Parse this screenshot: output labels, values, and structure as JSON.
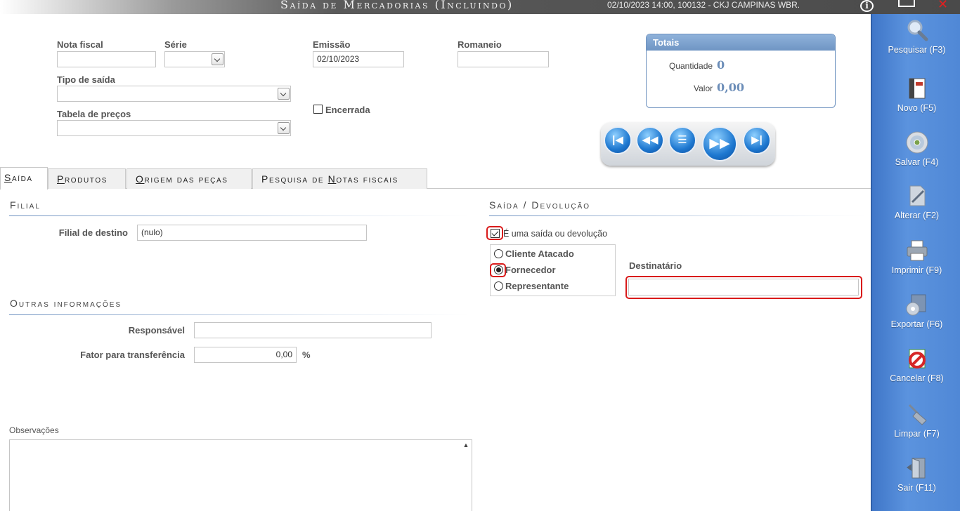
{
  "window": {
    "title": "Saída de Mercadorias (Incluindo)",
    "status": "02/10/2023 14:00, 100132 - CKJ CAMPINAS WBR.",
    "info_glyph": "i",
    "close_glyph": "✕"
  },
  "header": {
    "nota_fiscal_label": "Nota fiscal",
    "serie_label": "Série",
    "emissao_label": "Emissão",
    "emissao_value": "02/10/2023",
    "romaneio_label": "Romaneio",
    "tipo_saida_label": "Tipo de saída",
    "tabela_precos_label": "Tabela de preços",
    "encerrada_label": "Encerrada"
  },
  "totals": {
    "title": "Totais",
    "quantidade_label": "Quantidade",
    "quantidade_value": "0",
    "valor_label": "Valor",
    "valor_value": "0,00"
  },
  "tabs": [
    {
      "first": "S",
      "rest": "aída"
    },
    {
      "first": "P",
      "rest": "rodutos"
    },
    {
      "first": "O",
      "rest": "rigem das peças"
    },
    {
      "pre": "Pesquisa de ",
      "first": "N",
      "rest": "otas fiscais"
    }
  ],
  "filial": {
    "section": "Filial",
    "destino_label": "Filial de destino",
    "destino_value": "(nulo)"
  },
  "outras": {
    "section": "Outras informações",
    "responsavel_label": "Responsável",
    "fator_label": "Fator para transferência",
    "fator_value": "0,00",
    "fator_unit": "%"
  },
  "observacoes_label": "Observações",
  "saida_devolucao": {
    "section": "Saída / Devolução",
    "checkbox_label": "É uma saída ou devolução",
    "options": [
      "Cliente Atacado",
      "Fornecedor",
      "Representante"
    ],
    "selected": "Fornecedor",
    "destinatario_label": "Destinatário"
  },
  "sidebar": [
    {
      "label": "Pesquisar (F3)",
      "icon": "search-icon"
    },
    {
      "label": "Novo (F5)",
      "icon": "new-document-icon"
    },
    {
      "label": "Salvar (F4)",
      "icon": "disc-save-icon"
    },
    {
      "label": "Alterar (F2)",
      "icon": "edit-document-icon"
    },
    {
      "label": "Imprimir (F9)",
      "icon": "printer-icon"
    },
    {
      "label": "Exportar (F6)",
      "icon": "export-icon"
    },
    {
      "label": "Cancelar (F8)",
      "icon": "cancel-icon"
    },
    {
      "label": "Limpar (F7)",
      "icon": "broom-icon"
    },
    {
      "label": "Sair (F11)",
      "icon": "exit-door-icon"
    }
  ]
}
